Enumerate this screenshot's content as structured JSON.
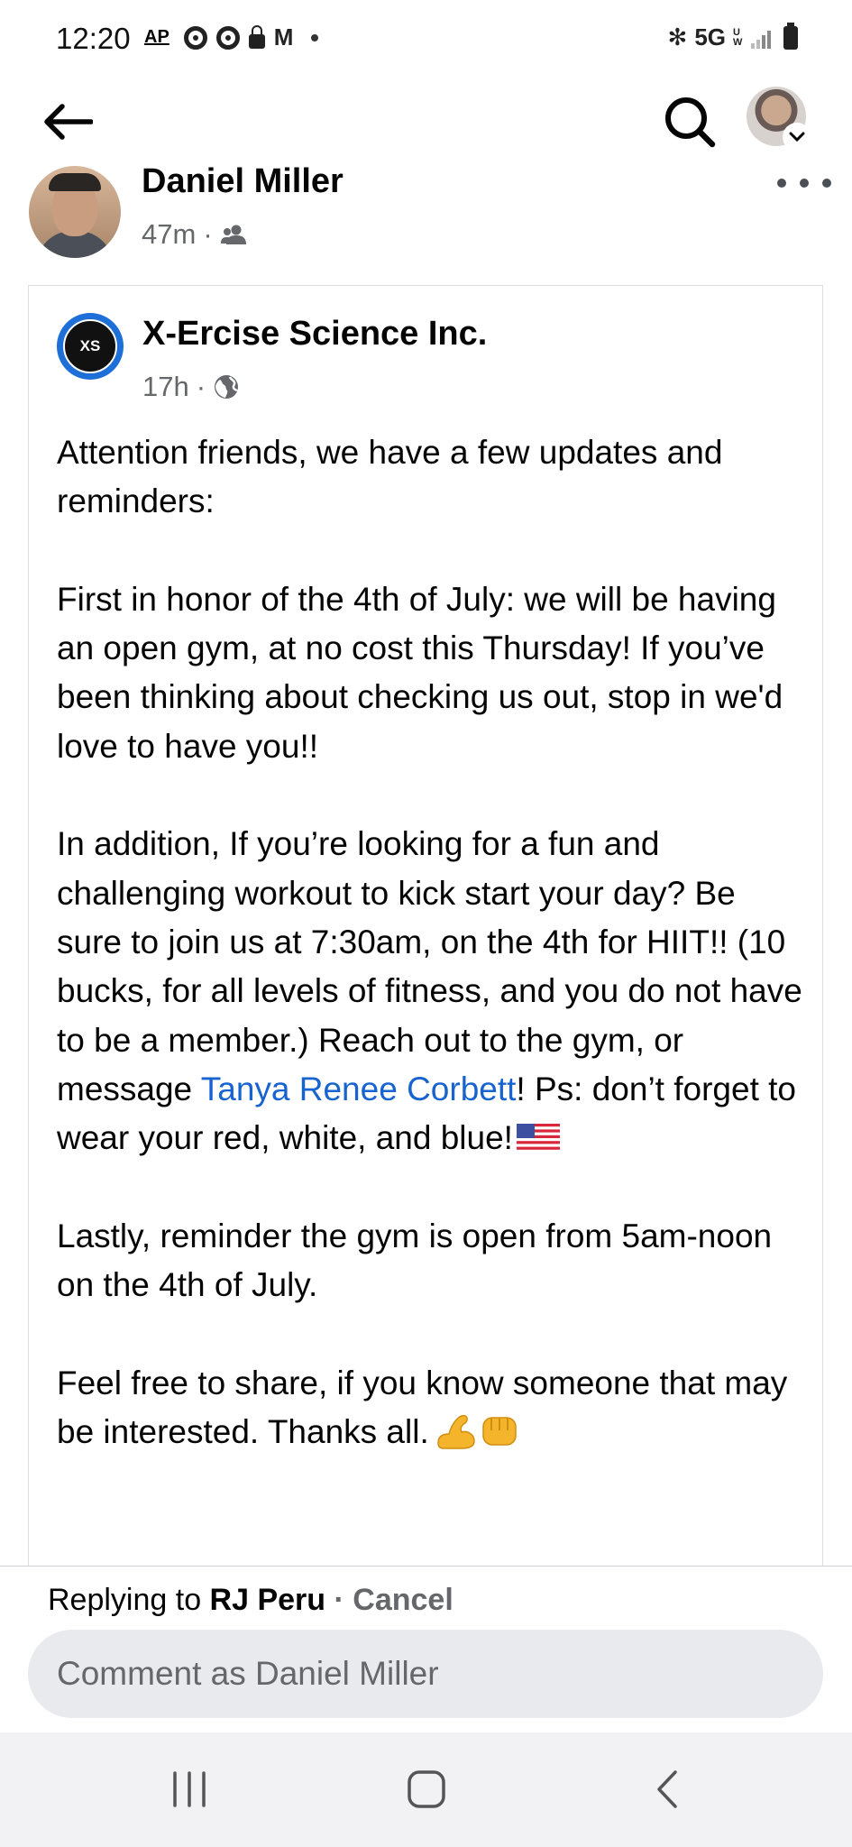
{
  "status_bar": {
    "time": "12:20",
    "ap_label": "AP",
    "network": "5G",
    "network_suffix": "UW"
  },
  "header": {
    "back_icon": "arrow-left-icon",
    "search_icon": "search-icon"
  },
  "author": {
    "name": "Daniel Miller",
    "time": "47m",
    "audience_icon": "friends-icon"
  },
  "shared_post": {
    "page_name": "X-Ercise Science Inc.",
    "avatar_text": "XS",
    "time": "17h",
    "audience_icon": "globe-icon",
    "paragraphs": {
      "p1": "Attention friends, we have a few updates and reminders:",
      "p2": "First in honor of the 4th of July: we will be having an open gym, at no cost this Thursday! If you’ve been thinking about checking us out, stop in we'd love to have you!!",
      "p3_before": "In addition, If you’re looking for a fun and challenging workout to kick start your day? Be sure to join us at 7:30am, on the 4th for HIIT!! (10 bucks, for all levels of fitness, and you do not have to be a member.) Reach out to the gym, or message ",
      "p3_mention": "Tanya Renee Corbett",
      "p3_after": "! Ps: don’t forget to wear your red, white, and blue!",
      "p4": "Lastly, reminder the gym is open from 5am-noon on the 4th of July.",
      "p5": "Feel free to share, if you know someone that may be interested. Thanks all."
    }
  },
  "reply": {
    "prefix": "Replying to ",
    "name": "RJ Peru",
    "separator": " · ",
    "cancel_label": "Cancel",
    "input_placeholder": "Comment as Daniel Miller"
  },
  "nav": {
    "recents_icon": "recents-icon",
    "home_icon": "home-icon",
    "back_icon": "nav-back-icon"
  },
  "colors": {
    "link": "#1763cf",
    "meta": "#65676b",
    "input_bg": "#e9eaed"
  }
}
